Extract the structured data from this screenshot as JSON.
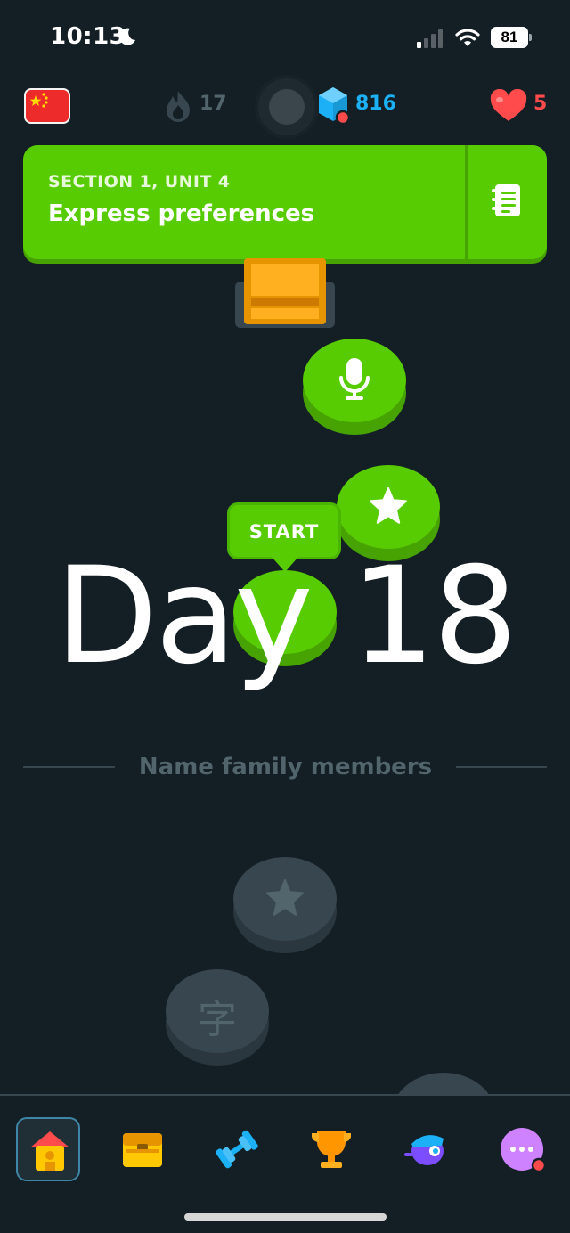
{
  "status_bar": {
    "time": "10:13",
    "battery": "81"
  },
  "stats": {
    "streak": "17",
    "gems": "816",
    "hearts": "5"
  },
  "unit": {
    "section": "SECTION 1, UNIT 4",
    "title": "Express preferences"
  },
  "path": {
    "start_label": "START",
    "overlay_text": "Day 18",
    "next_section": "Name family members",
    "kanji_char": "字"
  },
  "icons": {
    "flag": "china-flag-icon",
    "streak": "flame-icon",
    "gems": "gem-icon",
    "hearts": "heart-icon",
    "guidebook": "guidebook-icon",
    "nav": [
      "home-icon",
      "chest-icon",
      "dumbbell-icon",
      "trophy-icon",
      "character-icon",
      "more-icon"
    ]
  },
  "colors": {
    "accent_green": "#58cc02",
    "gem_blue": "#1cb0f6",
    "heart_red": "#ff4b4b",
    "background": "#131f24"
  }
}
